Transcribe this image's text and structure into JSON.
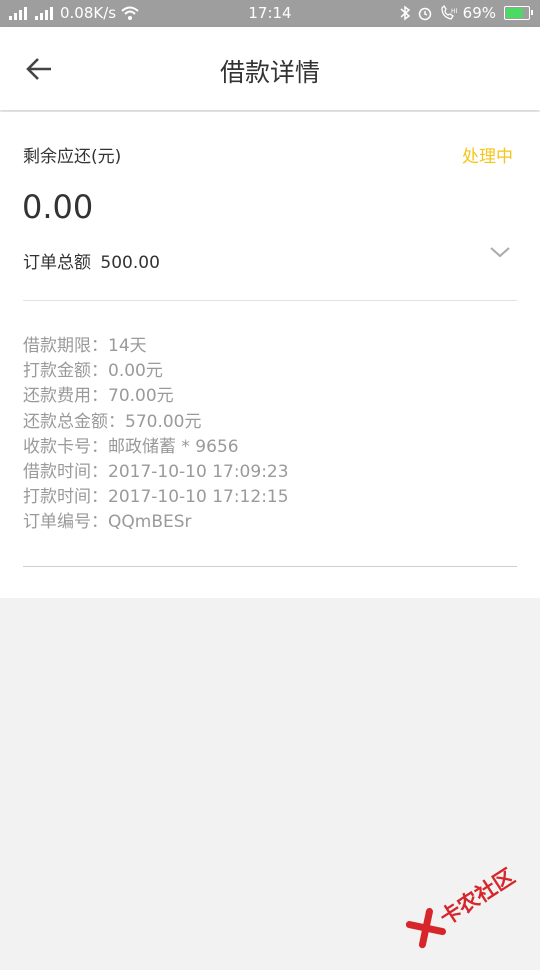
{
  "status_bar": {
    "network_speed": "0.08K/s",
    "time": "17:14",
    "battery": "69%",
    "battery_level": 0.69
  },
  "header": {
    "title": "借款详情"
  },
  "summary": {
    "remaining_label": "剩余应还(元)",
    "status": "处理中",
    "remaining_amount": "0.00",
    "order_total_label": "订单总额",
    "order_total_value": "500.00"
  },
  "details": [
    "借款期限：14天",
    "打款金额：0.00元",
    "还款费用：70.00元",
    "还款总金额：570.00元",
    "收款卡号：邮政储蓄 * 9656",
    "借款时间：2017-10-10 17:09:23",
    "打款时间：2017-10-10 17:12:15",
    "订单编号：QQmBESr"
  ],
  "watermark": {
    "text": "卡农社区"
  },
  "colors": {
    "status_yellow": "#f5c518",
    "status_bar_gray": "#9e9e9e",
    "watermark_red": "#d6262b"
  },
  "icons": [
    "signal-icon",
    "wifi-icon",
    "bluetooth-icon",
    "alarm-icon",
    "call-icon",
    "battery-icon",
    "back-arrow-icon",
    "chevron-down-icon",
    "watermark-logo-icon"
  ]
}
